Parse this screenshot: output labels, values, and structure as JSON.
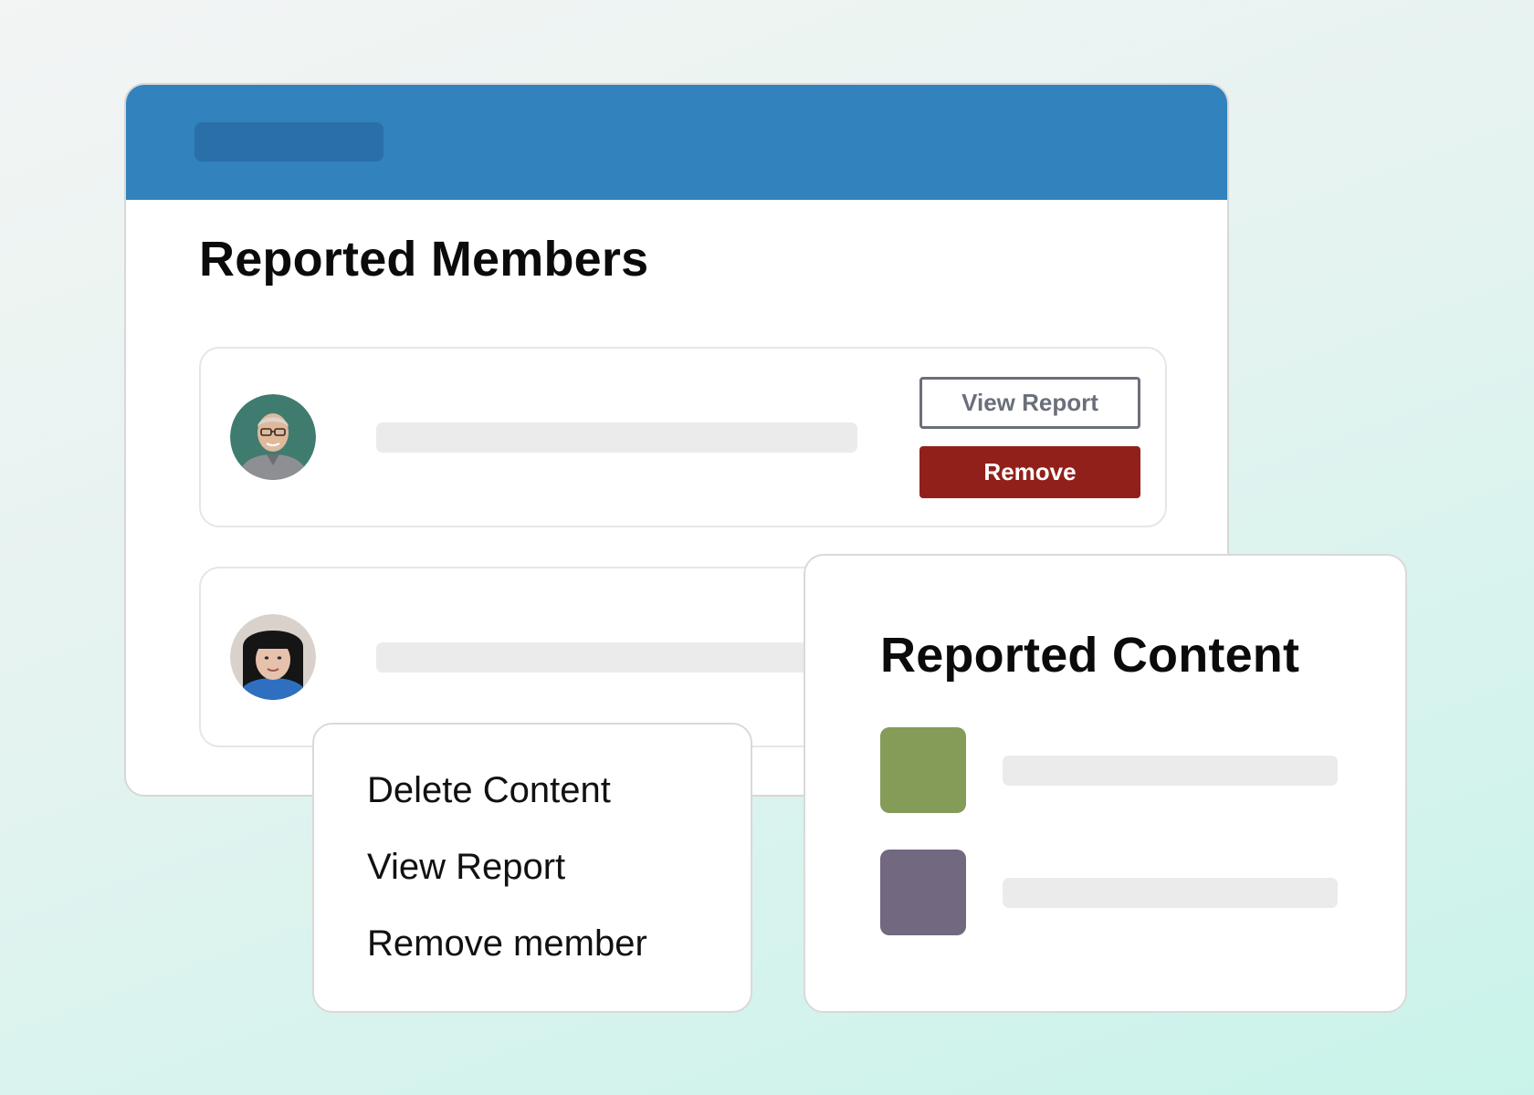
{
  "colors": {
    "header": "#3182bd",
    "remove_button": "#92201a",
    "thumb_green": "#849c58",
    "thumb_purple": "#72687f"
  },
  "members_panel": {
    "title": "Reported Members",
    "members": [
      {
        "avatar": "avatar-man-glasses",
        "actions": {
          "view_report": "View Report",
          "remove": "Remove"
        }
      },
      {
        "avatar": "avatar-woman-bangs"
      }
    ]
  },
  "context_menu": {
    "items": [
      "Delete Content",
      "View Report",
      "Remove member"
    ]
  },
  "content_panel": {
    "title": "Reported Content",
    "items": [
      {
        "thumb": "green-thumbnail"
      },
      {
        "thumb": "purple-thumbnail"
      }
    ]
  }
}
